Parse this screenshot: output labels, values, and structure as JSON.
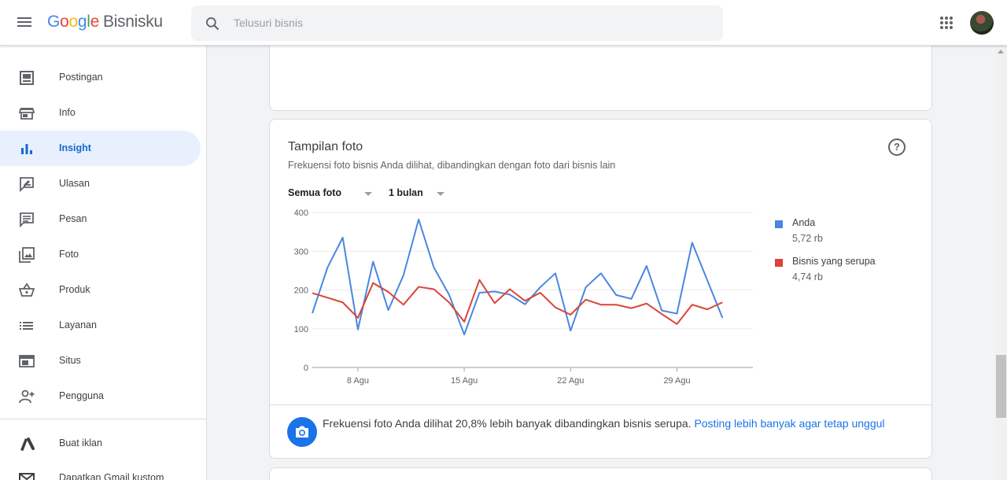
{
  "header": {
    "logo_google": [
      "G",
      "o",
      "o",
      "g",
      "l",
      "e"
    ],
    "logo_product": "Bisnisku",
    "search_placeholder": "Telusuri bisnis"
  },
  "sidebar": {
    "items": [
      {
        "label": "Postingan",
        "icon": "post-icon"
      },
      {
        "label": "Info",
        "icon": "store-icon"
      },
      {
        "label": "Insight",
        "icon": "insights-icon",
        "active": true
      },
      {
        "label": "Ulasan",
        "icon": "review-icon"
      },
      {
        "label": "Pesan",
        "icon": "message-icon"
      },
      {
        "label": "Foto",
        "icon": "photo-icon"
      },
      {
        "label": "Produk",
        "icon": "basket-icon"
      },
      {
        "label": "Layanan",
        "icon": "list-icon"
      },
      {
        "label": "Situs",
        "icon": "website-icon"
      },
      {
        "label": "Pengguna",
        "icon": "add-user-icon"
      },
      {
        "label": "Buat iklan",
        "icon": "ads-icon"
      },
      {
        "label": "Dapatkan Gmail kustom",
        "icon": "mail-icon"
      }
    ]
  },
  "card": {
    "title": "Tampilan foto",
    "subtitle": "Frekuensi foto bisnis Anda dilihat, dibandingkan dengan foto dari bisnis lain",
    "filter_photos": "Semua foto",
    "filter_period": "1 bulan",
    "help_symbol": "?",
    "footer_text": "Frekuensi foto Anda dilihat 20,8% lebih banyak dibandingkan bisnis serupa.",
    "footer_link": "Posting lebih banyak agar tetap unggul"
  },
  "legend": [
    {
      "name": "Anda",
      "value": "5,72 rb",
      "color": "#4a86e0"
    },
    {
      "name": "Bisnis yang serupa",
      "value": "4,74 rb",
      "color": "#db4437"
    }
  ],
  "chart_data": {
    "type": "line",
    "title": "Tampilan foto",
    "x": [
      1,
      2,
      3,
      4,
      5,
      6,
      7,
      8,
      9,
      10,
      11,
      12,
      13,
      14,
      15,
      16,
      17,
      18,
      19,
      20,
      21,
      22,
      23,
      24,
      25,
      26,
      27,
      28,
      29,
      30
    ],
    "xticks": [
      {
        "at": 4,
        "label": "8 Agu"
      },
      {
        "at": 11,
        "label": "15 Agu"
      },
      {
        "at": 18,
        "label": "22 Agu"
      },
      {
        "at": 25,
        "label": "29 Agu"
      }
    ],
    "yticks": [
      0,
      100,
      200,
      300,
      400
    ],
    "ylim": [
      0,
      400
    ],
    "grid": true,
    "series": [
      {
        "name": "Anda",
        "color": "#4a86e0",
        "values": [
          140,
          258,
          335,
          98,
          273,
          148,
          238,
          382,
          258,
          188,
          85,
          193,
          196,
          188,
          163,
          207,
          243,
          95,
          207,
          243,
          187,
          177,
          262,
          147,
          139,
          322,
          225,
          128
        ]
      },
      {
        "name": "Bisnis yang serupa",
        "color": "#db4437",
        "values": [
          192,
          180,
          168,
          128,
          218,
          195,
          162,
          208,
          202,
          168,
          118,
          226,
          166,
          202,
          172,
          193,
          155,
          136,
          175,
          162,
          162,
          153,
          165,
          138,
          112,
          162,
          150,
          168
        ]
      }
    ]
  }
}
